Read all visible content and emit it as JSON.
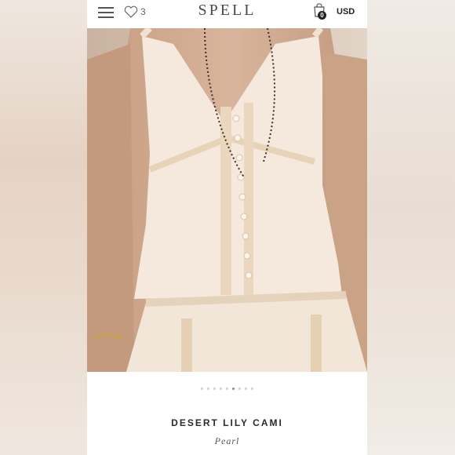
{
  "header": {
    "brand": "SPELL",
    "wishlist_count": "3",
    "cart_count": "0",
    "currency": "USD"
  },
  "icons": {
    "menu": "hamburger-menu-icon",
    "wishlist": "heart-icon",
    "cart": "shopping-bag-icon"
  },
  "gallery": {
    "total_images": 9,
    "active_index": 5
  },
  "product": {
    "name": "DESERT LILY CAMI",
    "color": "Pearl"
  }
}
